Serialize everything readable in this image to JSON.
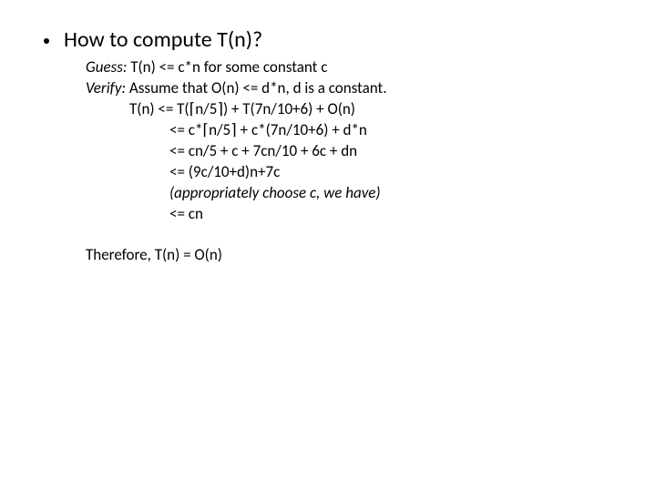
{
  "headline": "How to compute T(n)?",
  "guess_label": "Guess:",
  "guess_text": " T(n) <= c*n for some constant c",
  "verify_label": "Verify:",
  "verify_text": " Assume that O(n) <= d*n, d is a constant.",
  "lines": {
    "l1": "T(n) <= T(⌈n/5⌉) + T(7n/10+6) + O(n)",
    "l2": "<= c*⌈n/5⌉ + c*(7n/10+6) + d*n",
    "l3": "<= cn/5 + c + 7cn/10 + 6c + dn",
    "l4": "<= (9c/10+d)n+7c",
    "l5": "(appropriately choose c, we have)",
    "l6": "<= cn"
  },
  "conclusion": "Therefore, T(n) = O(n)"
}
